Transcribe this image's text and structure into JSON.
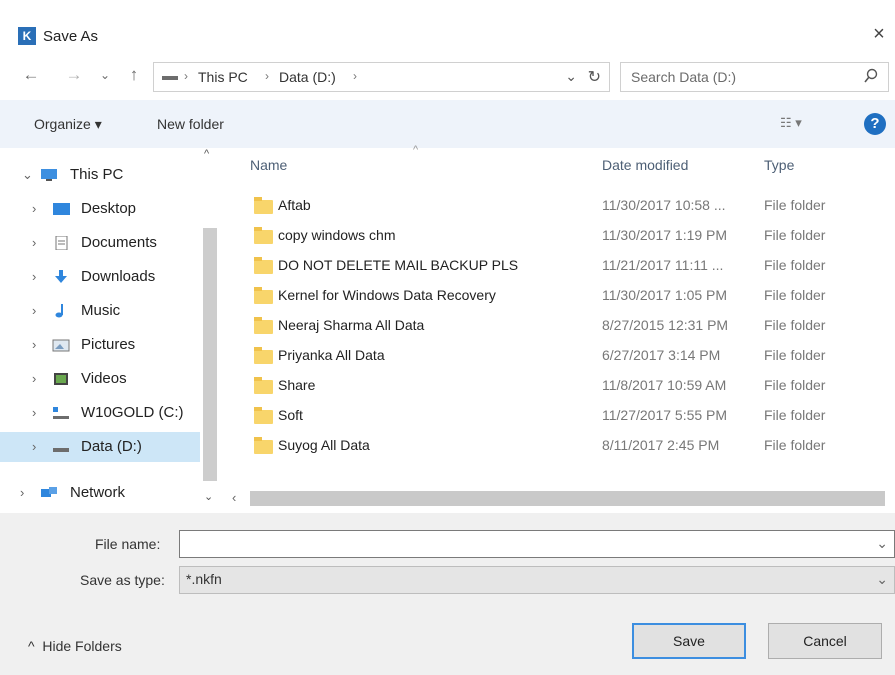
{
  "window": {
    "title": "Save As",
    "app_icon": "K",
    "close_glyph": "×"
  },
  "nav": {
    "back": "←",
    "forward": "→",
    "recent": "⌄",
    "up": "↑",
    "breadcrumbs": [
      "This PC",
      "Data (D:)"
    ],
    "refresh": "↻",
    "search_placeholder": "Search Data (D:)"
  },
  "toolbar": {
    "organize": "Organize ▾",
    "new_folder": "New folder",
    "help": "?"
  },
  "sidebar": {
    "items": [
      {
        "label": "This PC",
        "icon": "monitor-icon",
        "expanded": true
      },
      {
        "label": "Desktop",
        "icon": "desktop-icon"
      },
      {
        "label": "Documents",
        "icon": "documents-icon"
      },
      {
        "label": "Downloads",
        "icon": "download-arrow-icon"
      },
      {
        "label": "Music",
        "icon": "music-note-icon"
      },
      {
        "label": "Pictures",
        "icon": "pictures-icon"
      },
      {
        "label": "Videos",
        "icon": "video-icon"
      },
      {
        "label": "W10GOLD (C:)",
        "icon": "windows-drive-icon"
      },
      {
        "label": "Data (D:)",
        "icon": "drive-icon",
        "selected": true
      },
      {
        "label": "Network",
        "icon": "network-icon"
      }
    ]
  },
  "files": {
    "columns": [
      "Name",
      "Date modified",
      "Type"
    ],
    "rows": [
      {
        "name": "Aftab",
        "date": "11/30/2017 10:58 ...",
        "type": "File folder"
      },
      {
        "name": "copy windows chm",
        "date": "11/30/2017 1:19 PM",
        "type": "File folder"
      },
      {
        "name": "DO NOT DELETE MAIL BACKUP PLS",
        "date": "11/21/2017 11:11 ...",
        "type": "File folder"
      },
      {
        "name": "Kernel for Windows Data Recovery",
        "date": "11/30/2017 1:05 PM",
        "type": "File folder"
      },
      {
        "name": "Neeraj Sharma All Data",
        "date": "8/27/2015 12:31 PM",
        "type": "File folder"
      },
      {
        "name": "Priyanka All Data",
        "date": "6/27/2017 3:14 PM",
        "type": "File folder"
      },
      {
        "name": "Share",
        "date": "11/8/2017 10:59 AM",
        "type": "File folder"
      },
      {
        "name": "Soft",
        "date": "11/27/2017 5:55 PM",
        "type": "File folder"
      },
      {
        "name": "Suyog All Data",
        "date": "8/11/2017 2:45 PM",
        "type": "File folder"
      }
    ]
  },
  "form": {
    "file_name_label": "File name:",
    "file_name_value": "",
    "save_type_label": "Save as type:",
    "save_type_value": "*.nkfn"
  },
  "footer": {
    "hide_folders": "Hide Folders",
    "save": "Save",
    "cancel": "Cancel"
  },
  "colors": {
    "selection": "#cde6f7",
    "toolbar_bg": "#eef3fa",
    "folder": "#f8d56b",
    "help": "#1f6fc1"
  }
}
